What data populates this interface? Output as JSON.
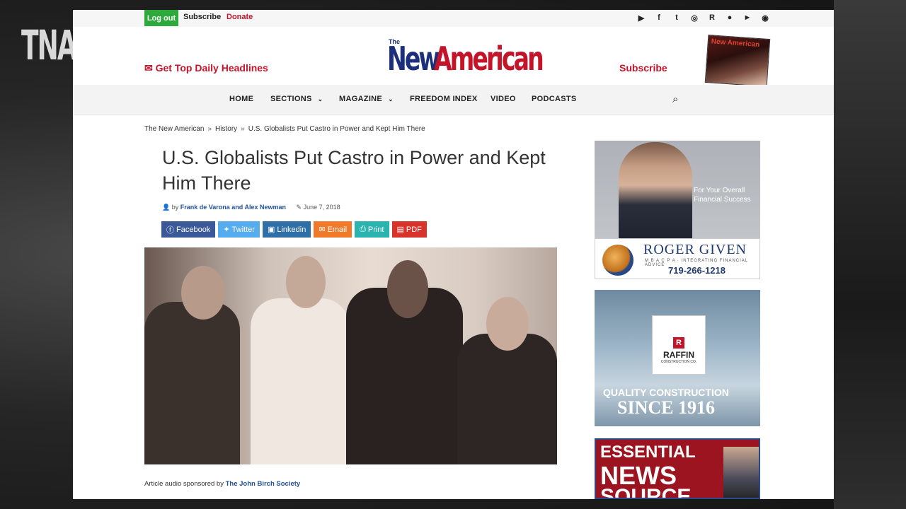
{
  "overlay": {
    "watermark": "TNA"
  },
  "topbar": {
    "logout": "Log out",
    "subscribe": "Subscribe",
    "donate": "Donate",
    "social_icons": [
      "play-icon",
      "facebook-icon",
      "twitter-icon",
      "instagram-icon",
      "rumble-icon",
      "apple-icon",
      "google-play-icon",
      "rss-icon"
    ]
  },
  "header": {
    "headlines_link": "Get Top Daily Headlines",
    "logo_small": "The",
    "logo_new": "New",
    "logo_american": "American",
    "subscribe": "Subscribe",
    "magazine_cover_title": "New American"
  },
  "nav": {
    "items": [
      {
        "label": "HOME"
      },
      {
        "label": "SECTIONS"
      },
      {
        "label": "MAGAZINE"
      },
      {
        "label": "FREEDOM INDEX"
      },
      {
        "label": "VIDEO"
      },
      {
        "label": "PODCASTS"
      }
    ]
  },
  "breadcrumb": [
    "The New American",
    "History",
    "U.S. Globalists Put Castro in Power and Kept Him There"
  ],
  "article": {
    "title": "U.S. Globalists Put Castro in Power and Kept Him There",
    "by": "by",
    "authors": "Frank de Varona and Alex Newman",
    "date": "June 7, 2018",
    "share": [
      {
        "label": "Facebook",
        "color": "#3b5998"
      },
      {
        "label": "Twitter",
        "color": "#55acee"
      },
      {
        "label": "Linkedin",
        "color": "#2f6fa8"
      },
      {
        "label": "Email",
        "color": "#f07a2a"
      },
      {
        "label": "Print",
        "color": "#2bb3b0"
      },
      {
        "label": "PDF",
        "color": "#d9342b"
      }
    ],
    "sponsor_prefix": "Article audio sponsored by",
    "sponsor_name": "The John Birch Society"
  },
  "ads": {
    "ad1": {
      "tagline": "For Your Overall Financial Success",
      "name": "ROGER GIVEN",
      "sub": "M B A C P A · INTEGRATING FINANCIAL ADVICE",
      "phone": "719-266-1218"
    },
    "ad2": {
      "letter": "R",
      "name": "RAFFIN",
      "sub": "CONSTRUCTION CO.",
      "line1": "QUALITY CONSTRUCTION",
      "line2": "SINCE 1916"
    },
    "ad3": {
      "line1": "ESSENTIAL",
      "line2": "NEWS",
      "line3": "SOURCE"
    }
  }
}
